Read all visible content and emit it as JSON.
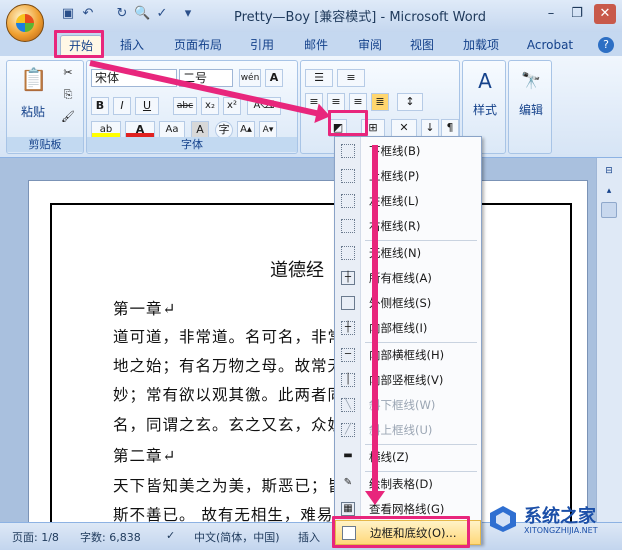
{
  "window": {
    "title": "Pretty—Boy [兼容模式] - Microsoft Word"
  },
  "tabs": [
    "开始",
    "插入",
    "页面布局",
    "引用",
    "邮件",
    "审阅",
    "视图",
    "加载项",
    "Acrobat"
  ],
  "ribbon": {
    "clipboard_label": "剪贴板",
    "paste_label": "粘贴",
    "font_label": "字体",
    "font_name": "宋体",
    "font_size": "二号",
    "wen_label": "wén",
    "style_label": "样式",
    "edit_label": "编辑"
  },
  "document": {
    "title": "道德经",
    "lines": [
      "第一章↵",
      "道可道，非常道。名可名，非常名。无名天",
      "地之始；有名万物之母。故常无欲以观其",
      "妙；常有欲以观其徼。此两者同出而异",
      "名，同谓之玄。玄之又玄，众妙之门。",
      "第二章↵",
      "天下皆知美之为美，斯恶已；皆知善之",
      "斯不善已。 故有无相生，难易相成，"
    ]
  },
  "border_menu": {
    "items": [
      {
        "label": "下框线(B)",
        "disabled": false
      },
      {
        "label": "上框线(P)",
        "disabled": false
      },
      {
        "label": "左框线(L)",
        "disabled": false
      },
      {
        "label": "右框线(R)",
        "disabled": false
      },
      {
        "label": "无框线(N)",
        "disabled": false
      },
      {
        "label": "所有框线(A)",
        "disabled": false
      },
      {
        "label": "外侧框线(S)",
        "disabled": false
      },
      {
        "label": "内部框线(I)",
        "disabled": false
      },
      {
        "label": "内部横框线(H)",
        "disabled": false
      },
      {
        "label": "内部竖框线(V)",
        "disabled": false
      },
      {
        "label": "斜下框线(W)",
        "disabled": true
      },
      {
        "label": "斜上框线(U)",
        "disabled": true
      },
      {
        "label": "横线(Z)",
        "disabled": false
      },
      {
        "label": "绘制表格(D)",
        "disabled": false
      },
      {
        "label": "查看网格线(G)",
        "disabled": false
      },
      {
        "label": "边框和底纹(O)...",
        "disabled": false
      }
    ]
  },
  "status": {
    "page": "页面: 1/8",
    "words": "字数: 6,838",
    "lang": "中文(简体，中国)",
    "mode": "插入"
  },
  "watermark": {
    "brand": "系统之家",
    "url": "XITONGZHIJIA.NET"
  },
  "colors": {
    "accent": "#e8267c",
    "ribbon": "#d6e4f5"
  }
}
